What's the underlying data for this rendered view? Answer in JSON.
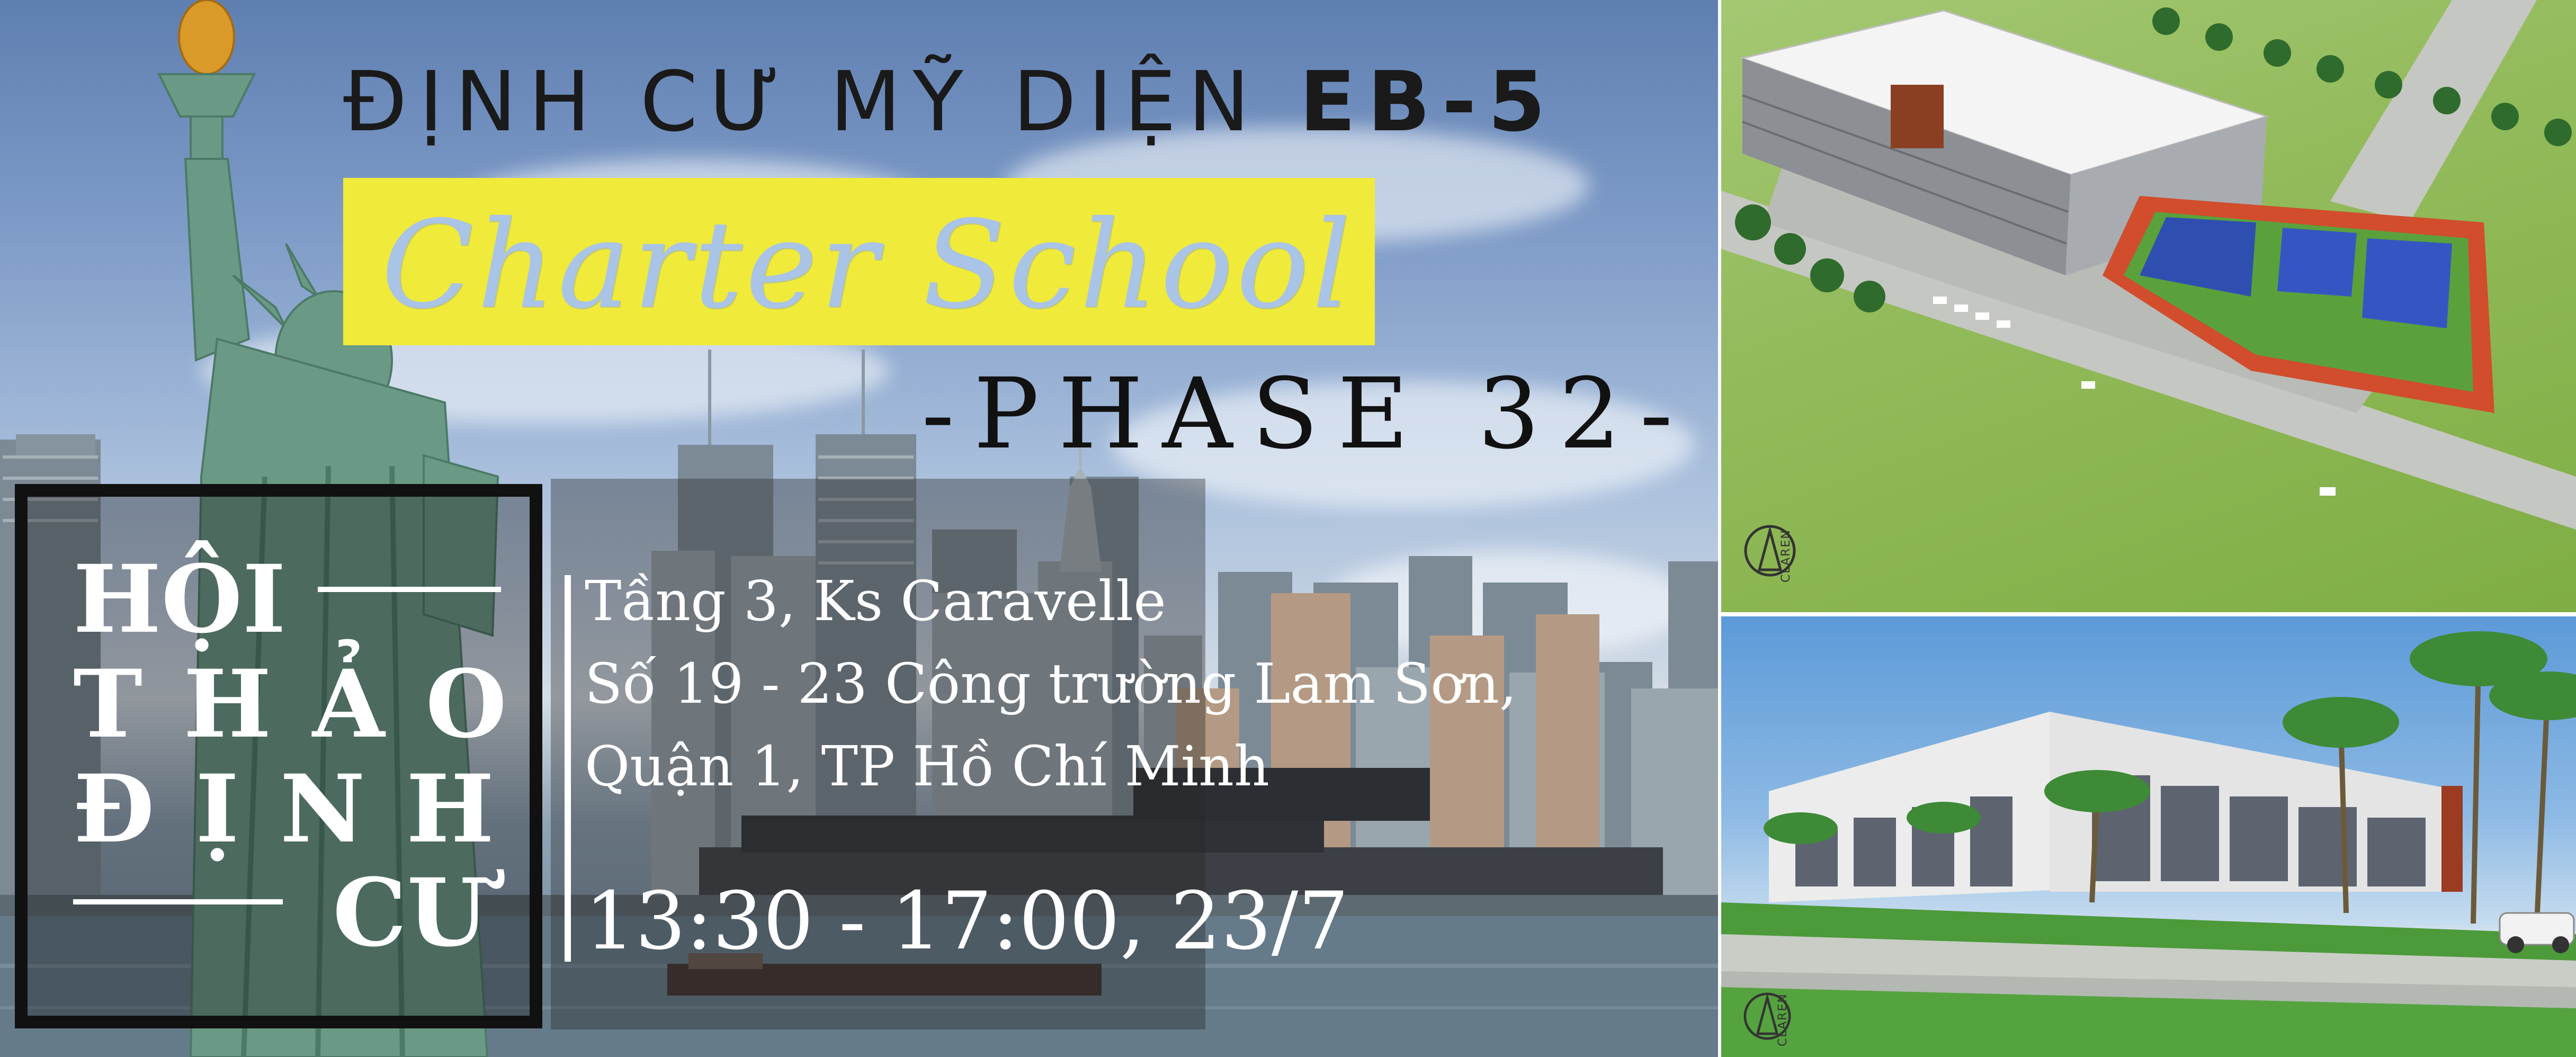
{
  "header": {
    "title_regular": "ĐỊNH CƯ MỸ DIỆN",
    "title_bold": "EB-5",
    "subtitle": "Charter School",
    "phase": "-PHASE 32-"
  },
  "seminar": {
    "line1": "HỘI",
    "line2": "T H Ả O",
    "line3": "Đ Ị N H",
    "line4": "CƯ"
  },
  "event": {
    "venue": "Tầng 3, Ks Caravelle",
    "address": "Số 19 - 23 Công trường Lam Sơn,",
    "district": "Quận 1, TP Hồ Chí Minh",
    "time": "13:30 - 17:00, 23/7"
  },
  "renders": {
    "top_logo": "CLAREN",
    "bottom_logo": "CLAREN"
  },
  "colors": {
    "highlight_yellow": "#f0ea3b",
    "subtitle_blue": "#a9c4e6",
    "title_dark": "#1a1a1a",
    "panel_white": "#ffffff"
  },
  "icons": [
    "statue-of-liberty-icon",
    "city-skyline-icon",
    "school-aerial-render-icon",
    "school-street-render-icon",
    "claren-logo-icon"
  ]
}
